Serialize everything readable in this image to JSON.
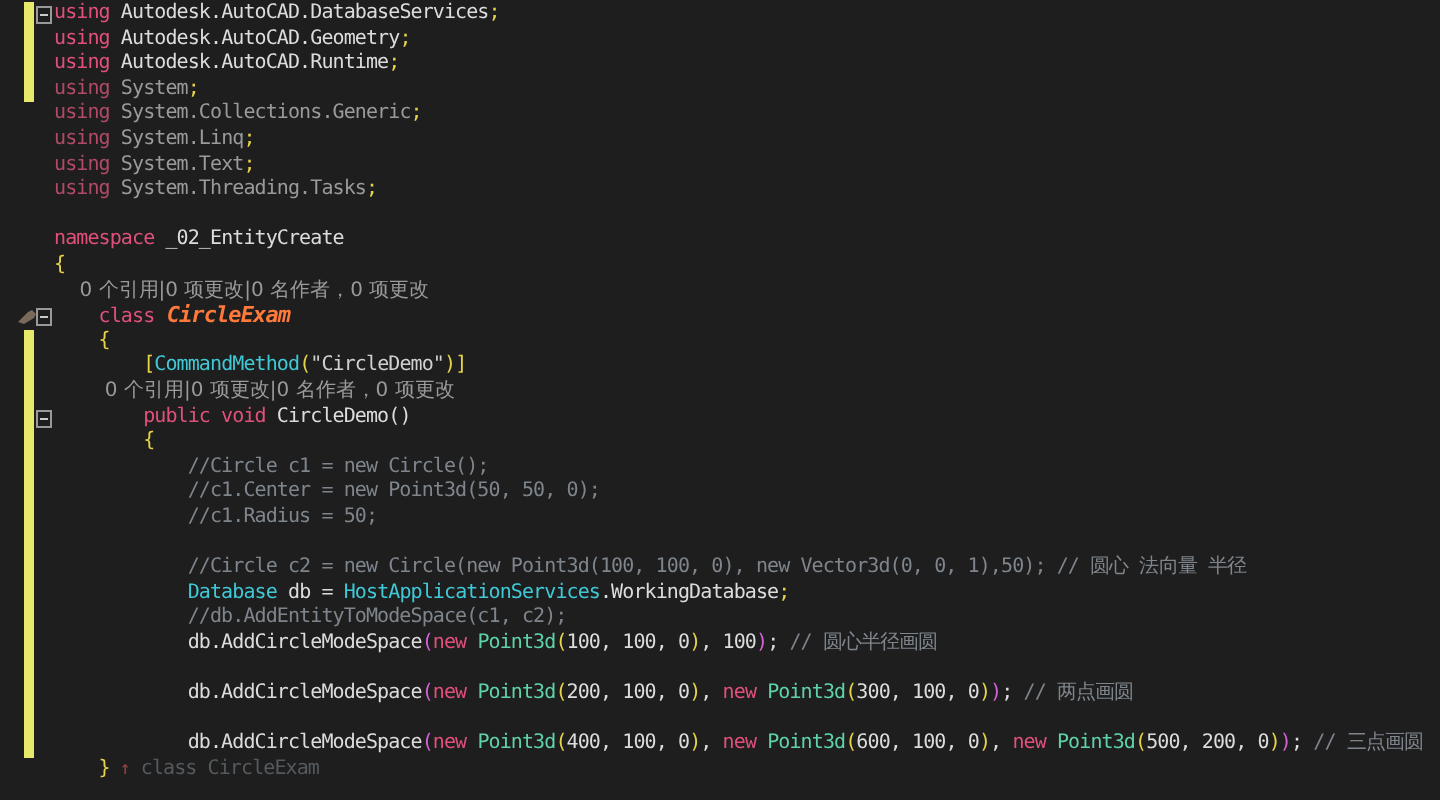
{
  "editor": {
    "lines": [
      {
        "changed": true,
        "fold": true,
        "tokens": [
          {
            "t": "using",
            "kind": "kw"
          },
          {
            "t": " Autodesk.AutoCAD.DatabaseServices",
            "kind": "plain"
          },
          {
            "t": ";",
            "kind": "punct"
          }
        ]
      },
      {
        "changed": true,
        "fold": false,
        "tokens": [
          {
            "t": "using",
            "kind": "kw"
          },
          {
            "t": " Autodesk.AutoCAD.Geometry",
            "kind": "plain"
          },
          {
            "t": ";",
            "kind": "punct"
          }
        ]
      },
      {
        "changed": true,
        "fold": false,
        "tokens": [
          {
            "t": "using",
            "kind": "kw"
          },
          {
            "t": " Autodesk.AutoCAD.Runtime",
            "kind": "plain"
          },
          {
            "t": ";",
            "kind": "punct"
          }
        ]
      },
      {
        "changed": true,
        "fold": false,
        "tokens": [
          {
            "t": "using",
            "kind": "kwdim"
          },
          {
            "t": " System",
            "kind": "dim"
          },
          {
            "t": ";",
            "kind": "punct"
          }
        ]
      },
      {
        "changed": false,
        "fold": false,
        "tokens": [
          {
            "t": "using",
            "kind": "kwdim"
          },
          {
            "t": " System.Collections.Generic",
            "kind": "dim"
          },
          {
            "t": ";",
            "kind": "punct"
          }
        ]
      },
      {
        "changed": false,
        "fold": false,
        "tokens": [
          {
            "t": "using",
            "kind": "kwdim"
          },
          {
            "t": " System.Linq",
            "kind": "dim"
          },
          {
            "t": ";",
            "kind": "punct"
          }
        ]
      },
      {
        "changed": false,
        "fold": false,
        "tokens": [
          {
            "t": "using",
            "kind": "kwdim"
          },
          {
            "t": " System.Text",
            "kind": "dim"
          },
          {
            "t": ";",
            "kind": "punct"
          }
        ]
      },
      {
        "changed": false,
        "fold": false,
        "tokens": [
          {
            "t": "using",
            "kind": "kwdim"
          },
          {
            "t": " System.Threading.Tasks",
            "kind": "dim"
          },
          {
            "t": ";",
            "kind": "punct"
          }
        ]
      },
      {
        "changed": false,
        "fold": false
      },
      {
        "changed": false,
        "fold": false,
        "tokens": [
          {
            "t": "namespace",
            "kind": "kw"
          },
          {
            "t": " _02_EntityCreate",
            "kind": "plain"
          }
        ]
      },
      {
        "changed": false,
        "fold": false,
        "tokens": [
          {
            "t": "{",
            "kind": "punct"
          }
        ]
      },
      {
        "changed": false,
        "fold": false,
        "tokens": [
          {
            "t": "    0 个引用|0 项更改|0 名作者，0 项更改",
            "kind": "lens"
          }
        ]
      },
      {
        "changed": false,
        "fold": true,
        "marker": true,
        "tokens": [
          {
            "t": "    class",
            "kind": "kw"
          },
          {
            "t": " CircleExam",
            "kind": "cls"
          }
        ]
      },
      {
        "changed": true,
        "fold": false,
        "tokens": [
          {
            "t": "    {",
            "kind": "punct"
          }
        ]
      },
      {
        "changed": true,
        "fold": false,
        "tokens": [
          {
            "t": "        [",
            "kind": "punct"
          },
          {
            "t": "CommandMethod",
            "kind": "type"
          },
          {
            "t": "(",
            "kind": "punct"
          },
          {
            "t": "\"CircleDemo\"",
            "kind": "str"
          },
          {
            "t": ")]",
            "kind": "punct"
          }
        ]
      },
      {
        "changed": true,
        "fold": false,
        "tokens": [
          {
            "t": "        0 个引用|0 项更改|0 名作者，0 项更改",
            "kind": "lens"
          }
        ]
      },
      {
        "changed": true,
        "fold": true,
        "tokens": [
          {
            "t": "        public void",
            "kind": "kw"
          },
          {
            "t": " CircleDemo()",
            "kind": "plain"
          }
        ]
      },
      {
        "changed": true,
        "fold": false,
        "tokens": [
          {
            "t": "        {",
            "kind": "punct"
          }
        ]
      },
      {
        "changed": true,
        "fold": false,
        "tokens": [
          {
            "t": "            //Circle c1 = new Circle();",
            "kind": "comment"
          }
        ]
      },
      {
        "changed": true,
        "fold": false,
        "tokens": [
          {
            "t": "            //c1.Center = new Point3d(50, 50, 0);",
            "kind": "comment"
          }
        ]
      },
      {
        "changed": true,
        "fold": false,
        "tokens": [
          {
            "t": "            //c1.Radius = 50;",
            "kind": "comment"
          }
        ]
      },
      {
        "changed": true,
        "fold": false
      },
      {
        "changed": true,
        "fold": false,
        "tokens": [
          {
            "t": "            //Circle c2 = new Circle(new Point3d(100, 100, 0), new Vector3d(0, 0, 1),50); // 圆心 法向量 半径",
            "kind": "comment"
          }
        ]
      },
      {
        "changed": true,
        "fold": false,
        "tokens": [
          {
            "t": "            Database",
            "kind": "type"
          },
          {
            "t": " db = ",
            "kind": "plain"
          },
          {
            "t": "HostApplicationServices",
            "kind": "type"
          },
          {
            "t": ".WorkingDatabase",
            "kind": "plain"
          },
          {
            "t": ";",
            "kind": "punct"
          }
        ]
      },
      {
        "changed": true,
        "fold": false,
        "tokens": [
          {
            "t": "            //db.AddEntityToModeSpace(c1, c2);",
            "kind": "comment"
          }
        ]
      },
      {
        "changed": true,
        "fold": false,
        "tokens": [
          {
            "t": "            db.AddCircleModeSpace",
            "kind": "plain"
          },
          {
            "t": "(",
            "kind": "paren"
          },
          {
            "t": "new",
            "kind": "kw"
          },
          {
            "t": " Point3d",
            "kind": "ctor"
          },
          {
            "t": "(",
            "kind": "punct"
          },
          {
            "t": "100, 100, 0",
            "kind": "plain"
          },
          {
            "t": ")",
            "kind": "punct"
          },
          {
            "t": ", 100",
            "kind": "plain"
          },
          {
            "t": ")",
            "kind": "paren"
          },
          {
            "t": ";",
            "kind": "plain"
          },
          {
            "t": " // 圆心半径画圆",
            "kind": "comment"
          }
        ]
      },
      {
        "changed": true,
        "fold": false
      },
      {
        "changed": true,
        "fold": false,
        "tokens": [
          {
            "t": "            db.AddCircleModeSpace",
            "kind": "plain"
          },
          {
            "t": "(",
            "kind": "paren"
          },
          {
            "t": "new",
            "kind": "kw"
          },
          {
            "t": " Point3d",
            "kind": "ctor"
          },
          {
            "t": "(",
            "kind": "punct"
          },
          {
            "t": "200, 100, 0",
            "kind": "plain"
          },
          {
            "t": ")",
            "kind": "punct"
          },
          {
            "t": ", ",
            "kind": "plain"
          },
          {
            "t": "new",
            "kind": "kw"
          },
          {
            "t": " Point3d",
            "kind": "ctor"
          },
          {
            "t": "(",
            "kind": "punct"
          },
          {
            "t": "300, 100, 0",
            "kind": "plain"
          },
          {
            "t": ")",
            "kind": "punct"
          },
          {
            "t": ")",
            "kind": "paren"
          },
          {
            "t": ";",
            "kind": "plain"
          },
          {
            "t": " // 两点画圆",
            "kind": "comment"
          }
        ]
      },
      {
        "changed": true,
        "fold": false
      },
      {
        "changed": true,
        "fold": false,
        "tokens": [
          {
            "t": "            db.AddCircleModeSpace",
            "kind": "plain"
          },
          {
            "t": "(",
            "kind": "paren"
          },
          {
            "t": "new",
            "kind": "kw"
          },
          {
            "t": " Point3d",
            "kind": "ctor"
          },
          {
            "t": "(",
            "kind": "punct"
          },
          {
            "t": "400, 100, 0",
            "kind": "plain"
          },
          {
            "t": ")",
            "kind": "punct"
          },
          {
            "t": ", ",
            "kind": "plain"
          },
          {
            "t": "new",
            "kind": "kw"
          },
          {
            "t": " Point3d",
            "kind": "ctor"
          },
          {
            "t": "(",
            "kind": "punct"
          },
          {
            "t": "600, 100, 0",
            "kind": "plain"
          },
          {
            "t": ")",
            "kind": "punct"
          },
          {
            "t": ", ",
            "kind": "plain"
          },
          {
            "t": "new",
            "kind": "kw"
          },
          {
            "t": " Point3d",
            "kind": "ctor"
          },
          {
            "t": "(",
            "kind": "punct"
          },
          {
            "t": "500, 200, 0",
            "kind": "plain"
          },
          {
            "t": ")",
            "kind": "punct"
          },
          {
            "t": ")",
            "kind": "paren"
          },
          {
            "t": ";",
            "kind": "plain"
          },
          {
            "t": " // 三点画圆",
            "kind": "comment"
          }
        ]
      },
      {
        "changed": false,
        "fold": false,
        "tokens": [
          {
            "t": "    }",
            "kind": "punct"
          },
          {
            "t": " ↑",
            "kind": "arrow"
          },
          {
            "t": " class CircleExam",
            "kind": "hint"
          }
        ]
      }
    ]
  }
}
